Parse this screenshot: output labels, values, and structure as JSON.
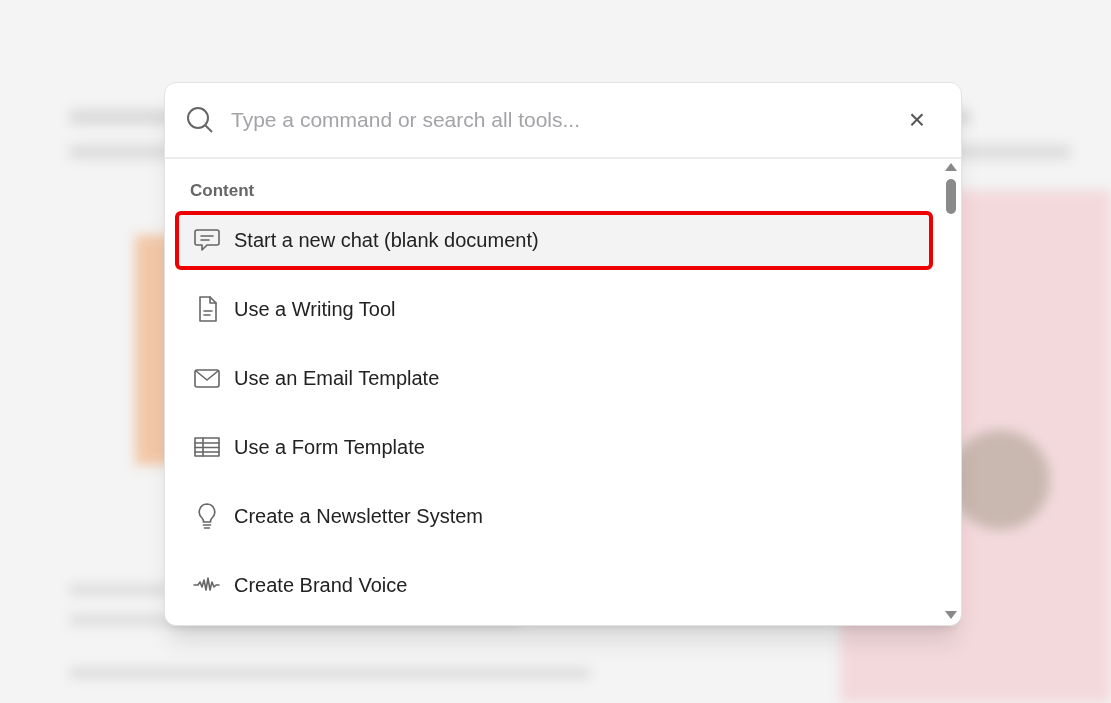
{
  "search": {
    "placeholder": "Type a command or search all tools...",
    "close": "×"
  },
  "section": {
    "title": "Content"
  },
  "items": [
    {
      "kind": "chat",
      "label": "Start a new chat (blank document)",
      "selected": true
    },
    {
      "kind": "document",
      "label": "Use a Writing Tool",
      "selected": false
    },
    {
      "kind": "email",
      "label": "Use an Email Template",
      "selected": false
    },
    {
      "kind": "form",
      "label": "Use a Form Template",
      "selected": false
    },
    {
      "kind": "bulb",
      "label": "Create a Newsletter System",
      "selected": false
    },
    {
      "kind": "wave",
      "label": "Create Brand Voice",
      "selected": false
    }
  ]
}
